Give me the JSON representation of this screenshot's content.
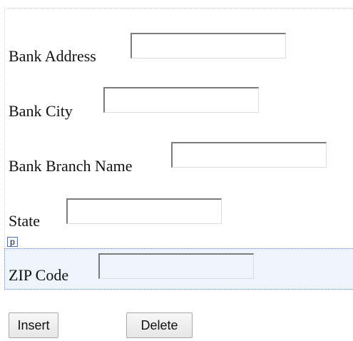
{
  "form": {
    "fields": [
      {
        "label": "Bank Address",
        "value": ""
      },
      {
        "label": "Bank City",
        "value": ""
      },
      {
        "label": "Bank Branch Name",
        "value": ""
      },
      {
        "label": "State",
        "value": ""
      },
      {
        "label": "ZIP Code",
        "value": ""
      }
    ],
    "paragraph_tag": "p"
  },
  "buttons": {
    "insert_label": "Insert",
    "delete_label": "Delete"
  },
  "colors": {
    "selection_background": "#eef4fb",
    "selection_border": "#6b86c4",
    "field_border_dark": "#7b7b7b",
    "button_border": "#a9a9a9"
  }
}
